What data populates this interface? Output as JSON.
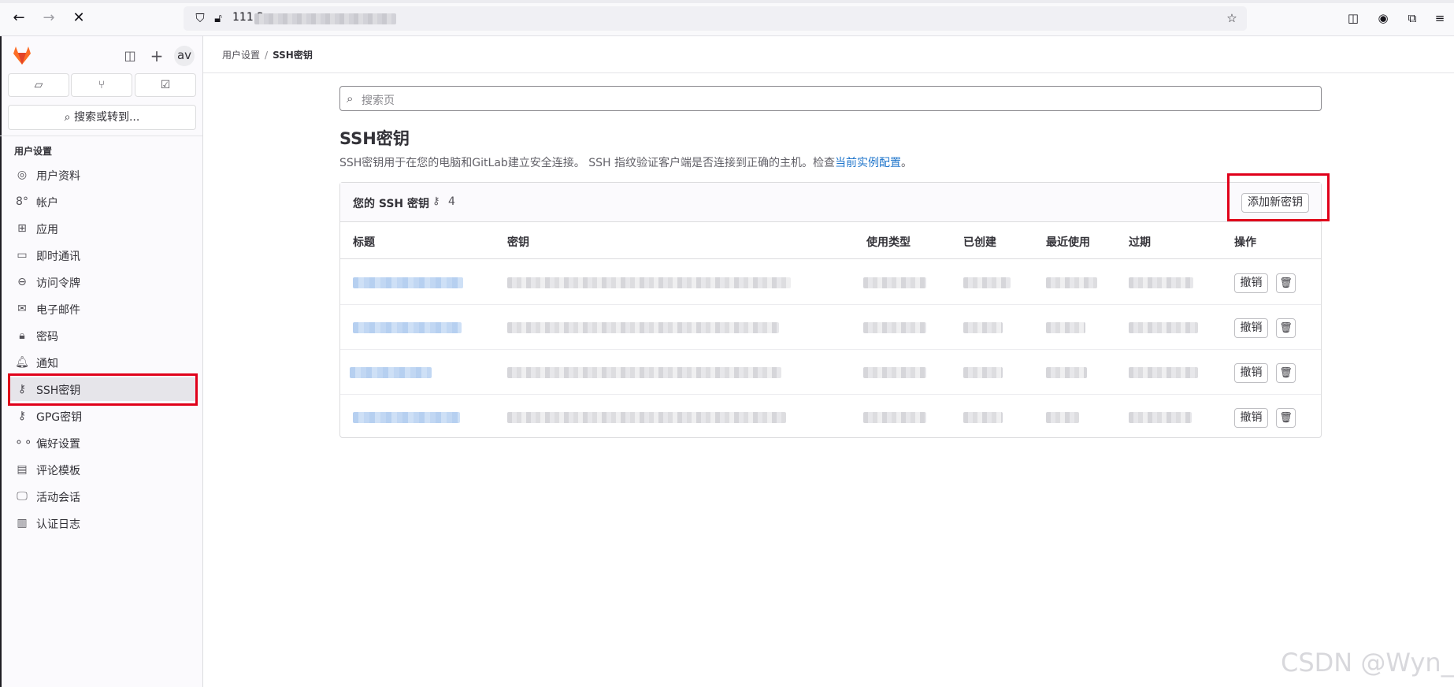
{
  "browser": {
    "url_prefix": "111.2",
    "icons": {
      "back": "arrow-left-icon",
      "forward": "arrow-right-icon",
      "stop": "close-icon",
      "shield": "shield-icon",
      "insecure": "lock-slash-icon",
      "bookmark": "star-icon",
      "pocket": "pocket-icon",
      "account": "account-icon",
      "extensions": "puzzle-icon",
      "menu": "hamburger-icon"
    }
  },
  "sidebar": {
    "avatar_text": "av",
    "search_label": "搜索或转到...",
    "section_title": "用户设置",
    "items": [
      {
        "label": "用户资料",
        "icon": "profile-icon"
      },
      {
        "label": "帐户",
        "icon": "account-icon"
      },
      {
        "label": "应用",
        "icon": "apps-icon"
      },
      {
        "label": "即时通讯",
        "icon": "chat-icon"
      },
      {
        "label": "访问令牌",
        "icon": "token-icon"
      },
      {
        "label": "电子邮件",
        "icon": "mail-icon"
      },
      {
        "label": "密码",
        "icon": "lock-icon"
      },
      {
        "label": "通知",
        "icon": "bell-icon"
      },
      {
        "label": "SSH密钥",
        "icon": "key-icon",
        "active": true
      },
      {
        "label": "GPG密钥",
        "icon": "key-icon"
      },
      {
        "label": "偏好设置",
        "icon": "preferences-icon"
      },
      {
        "label": "评论模板",
        "icon": "comment-icon"
      },
      {
        "label": "活动会话",
        "icon": "monitor-icon"
      },
      {
        "label": "认证日志",
        "icon": "log-icon"
      }
    ]
  },
  "breadcrumb": {
    "parent": "用户设置",
    "sep": "/",
    "current": "SSH密钥"
  },
  "page": {
    "search_placeholder": "搜索页",
    "title": "SSH密钥",
    "description": "SSH密钥用于在您的电脑和GitLab建立安全连接。 SSH 指纹验证客户端是否连接到正确的主机。检查",
    "description_link": "当前实例配置",
    "description_end": "。"
  },
  "card": {
    "title": "您的 SSH 密钥",
    "count": "4",
    "add_button": "添加新密钥",
    "columns": [
      "标题",
      "密钥",
      "使用类型",
      "已创建",
      "最近使用",
      "过期",
      "操作"
    ],
    "row_actions": {
      "revoke": "撤销",
      "delete_icon": "trash-icon"
    }
  },
  "watermark": "CSDN @Wyn_",
  "colors": {
    "accent": "#1f75cb",
    "highlight": "#e0001a",
    "brand": "#fc6d26"
  }
}
